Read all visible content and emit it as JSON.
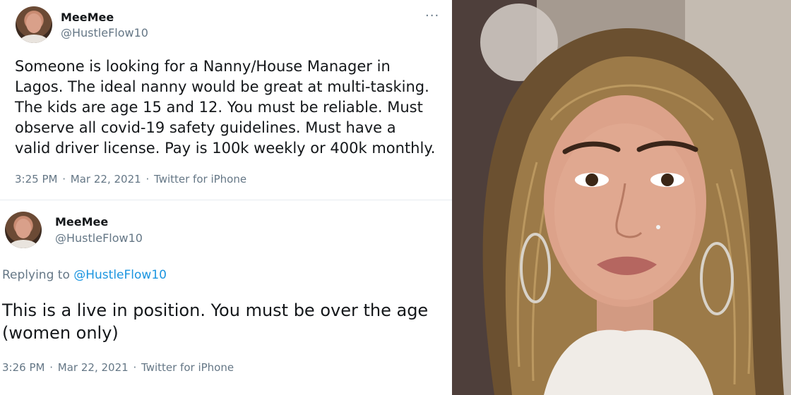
{
  "tweets": [
    {
      "name": "MeeMee",
      "handle": "@HustleFlow10",
      "more": "···",
      "text": "Someone is looking for a Nanny/House Manager in\nLagos. The ideal nanny would be great at multi-tasking.\nThe kids are age 15 and 12. You must be reliable. Must\nobserve all covid-19 safety guidelines. Must have a\nvalid driver license. Pay is 100k weekly or 400k monthly.",
      "time": "3:25 PM",
      "date": "Mar 22, 2021",
      "source": "Twitter for iPhone"
    },
    {
      "name": "MeeMee",
      "handle": "@HustleFlow10",
      "replying_prefix": "Replying to",
      "replying_handle": "@HustleFlow10",
      "text": "This is a live in position. You must be over the age\n(women only)",
      "time": "3:26 PM",
      "date": "Mar 22, 2021",
      "source": "Twitter for iPhone"
    }
  ],
  "separator": "·",
  "colors": {
    "link": "#1b95e0",
    "muted": "#657786",
    "text": "#14171a"
  }
}
